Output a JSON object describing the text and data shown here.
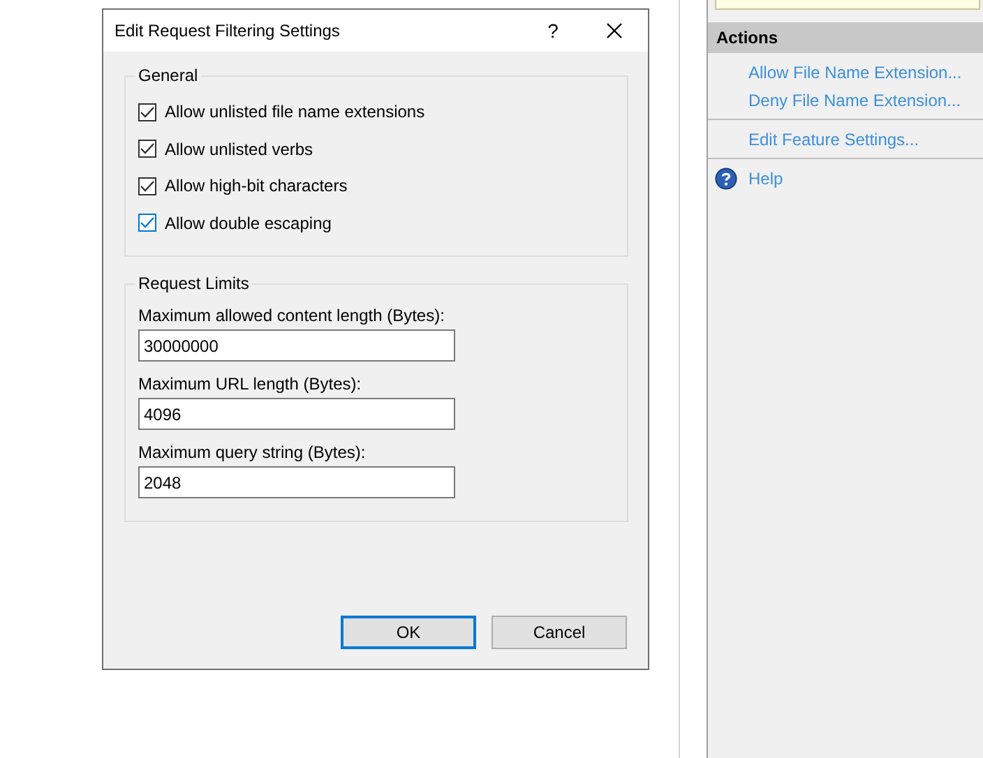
{
  "dialog": {
    "title": "Edit Request Filtering Settings",
    "help_button": "?",
    "groups": [
      {
        "kind": "checks",
        "title": "General",
        "items": [
          {
            "label": "Allow unlisted file name extensions",
            "checked": true,
            "focused": false
          },
          {
            "label": "Allow unlisted verbs",
            "checked": true,
            "focused": false
          },
          {
            "label": "Allow high-bit characters",
            "checked": true,
            "focused": false
          },
          {
            "label": "Allow double escaping",
            "checked": true,
            "focused": true
          }
        ]
      },
      {
        "kind": "fields",
        "title": "Request Limits",
        "items": [
          {
            "label": "Maximum allowed content length (Bytes):",
            "value": "30000000"
          },
          {
            "label": "Maximum URL length (Bytes):",
            "value": "4096"
          },
          {
            "label": "Maximum query string (Bytes):",
            "value": "2048"
          }
        ]
      }
    ],
    "buttons": [
      {
        "label": "OK",
        "default": true
      },
      {
        "label": "Cancel",
        "default": false
      }
    ]
  },
  "actions": {
    "title": "Actions",
    "sections": [
      [
        {
          "label": "Allow File Name Extension...",
          "kind": "link"
        },
        {
          "label": "Deny File Name Extension...",
          "kind": "link"
        }
      ],
      [
        {
          "label": "Edit Feature Settings...",
          "kind": "link"
        }
      ],
      [
        {
          "label": "Help",
          "kind": "help"
        }
      ]
    ]
  }
}
